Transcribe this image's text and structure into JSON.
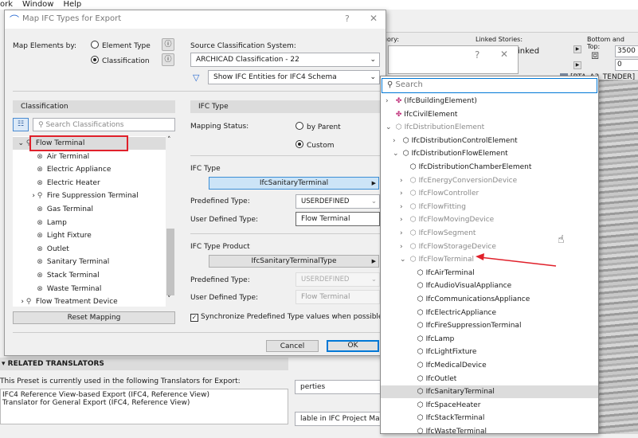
{
  "menubar": {
    "items": [
      "ork",
      "Window",
      "Help"
    ]
  },
  "background": {
    "category_label": "egory:",
    "linked_stories_label": "Linked Stories:",
    "linked_value": "inked",
    "bottom_top_label": "Bottom and Top:",
    "top_value": "3500",
    "bottom_value": "0",
    "view_tab": "[PTA_A3_TENDER]",
    "related_translators": {
      "header": "RELATED TRANSLATORS",
      "intro": "This Preset is currently used in the following Translators for Export:",
      "items": [
        "IFC4 Reference View-based Export (IFC4, Reference View)",
        "Translator for General Export (IFC4, Reference View)"
      ]
    },
    "properties_fragment": "perties",
    "project_manager_fragment": "lable in IFC Project Manage"
  },
  "dialog": {
    "title": "Map IFC Types for Export",
    "help": "?",
    "close": "✕",
    "map_by_label": "Map Elements by:",
    "map_by_options": [
      {
        "label": "Element Type",
        "selected": false
      },
      {
        "label": "Classification",
        "selected": true
      }
    ],
    "source_label": "Source Classification System:",
    "source_value": "ARCHICAD Classification - 22",
    "filter_value": "Show IFC Entities for IFC4 Schema",
    "classification_header": "Classification",
    "search_placeholder": "Search Classifications",
    "tree": [
      {
        "label": "Flow Terminal",
        "level": 0,
        "chevron": "down",
        "selected": true
      },
      {
        "label": "Air Terminal",
        "level": 1
      },
      {
        "label": "Electric Appliance",
        "level": 1
      },
      {
        "label": "Electric Heater",
        "level": 1
      },
      {
        "label": "Fire Suppression Terminal",
        "level": 1,
        "chevron": "right"
      },
      {
        "label": "Gas Terminal",
        "level": 1
      },
      {
        "label": "Lamp",
        "level": 1
      },
      {
        "label": "Light Fixture",
        "level": 1
      },
      {
        "label": "Outlet",
        "level": 1
      },
      {
        "label": "Sanitary Terminal",
        "level": 1
      },
      {
        "label": "Stack Terminal",
        "level": 1
      },
      {
        "label": "Waste Terminal",
        "level": 1
      },
      {
        "label": "Flow Treatment Device",
        "level": 0,
        "chevron": "right"
      }
    ],
    "reset_label": "Reset Mapping",
    "ifc_type_header": "IFC Type",
    "mapping_status_label": "Mapping Status:",
    "mapping_options": [
      {
        "label": "by Parent",
        "selected": false
      },
      {
        "label": "Custom",
        "selected": true
      }
    ],
    "ifc_type_label": "IFC Type",
    "ifc_type_value": "IfcSanitaryTerminal",
    "predefined_label": "Predefined Type:",
    "predefined_value": "USERDEFINED",
    "user_defined_label": "User Defined Type:",
    "user_defined_value": "Flow Terminal",
    "type_product_label": "IFC Type Product",
    "type_product_value": "IfcSanitaryTerminalType",
    "tp_predefined_value": "USERDEFINED",
    "tp_user_defined_value": "Flow Terminal",
    "sync_label": "Synchronize Predefined Type values when possible",
    "sync_checked": true,
    "cancel_label": "Cancel",
    "ok_label": "OK"
  },
  "back_dialog": {
    "help": "?",
    "close": "✕"
  },
  "dropdown": {
    "search_placeholder": "Search",
    "selected_index": 22,
    "items": [
      {
        "label": "(IfcBuildingElement)",
        "level": 0,
        "chevron": "right",
        "icon": "colored"
      },
      {
        "label": "IfcCivilElement",
        "level": 0,
        "icon": "colored"
      },
      {
        "label": "IfcDistributionElement",
        "level": 0,
        "chevron": "down",
        "muted": true
      },
      {
        "label": "IfcDistributionControlElement",
        "level": 1,
        "chevron": "right"
      },
      {
        "label": "IfcDistributionFlowElement",
        "level": 1,
        "chevron": "down"
      },
      {
        "label": "IfcDistributionChamberElement",
        "level": 2
      },
      {
        "label": "IfcEnergyConversionDevice",
        "level": 2,
        "chevron": "right",
        "muted": true
      },
      {
        "label": "IfcFlowController",
        "level": 2,
        "chevron": "right",
        "muted": true
      },
      {
        "label": "IfcFlowFitting",
        "level": 2,
        "chevron": "right",
        "muted": true
      },
      {
        "label": "IfcFlowMovingDevice",
        "level": 2,
        "chevron": "right",
        "muted": true
      },
      {
        "label": "IfcFlowSegment",
        "level": 2,
        "chevron": "right",
        "muted": true
      },
      {
        "label": "IfcFlowStorageDevice",
        "level": 2,
        "chevron": "right",
        "muted": true
      },
      {
        "label": "IfcFlowTerminal",
        "level": 2,
        "chevron": "down",
        "muted": true
      },
      {
        "label": "IfcAirTerminal",
        "level": 3
      },
      {
        "label": "IfcAudioVisualAppliance",
        "level": 3
      },
      {
        "label": "IfcCommunicationsAppliance",
        "level": 3
      },
      {
        "label": "IfcElectricAppliance",
        "level": 3
      },
      {
        "label": "IfcFireSuppressionTerminal",
        "level": 3
      },
      {
        "label": "IfcLamp",
        "level": 3
      },
      {
        "label": "IfcLightFixture",
        "level": 3
      },
      {
        "label": "IfcMedicalDevice",
        "level": 3
      },
      {
        "label": "IfcOutlet",
        "level": 3
      },
      {
        "label": "IfcSanitaryTerminal",
        "level": 3
      },
      {
        "label": "IfcSpaceHeater",
        "level": 3
      },
      {
        "label": "IfcStackTerminal",
        "level": 3
      },
      {
        "label": "IfcWasteTerminal",
        "level": 3
      }
    ]
  },
  "colors": {
    "annotation_red": "#e0202a",
    "selection_blue": "#cce4f7",
    "accent": "#0078d7"
  }
}
